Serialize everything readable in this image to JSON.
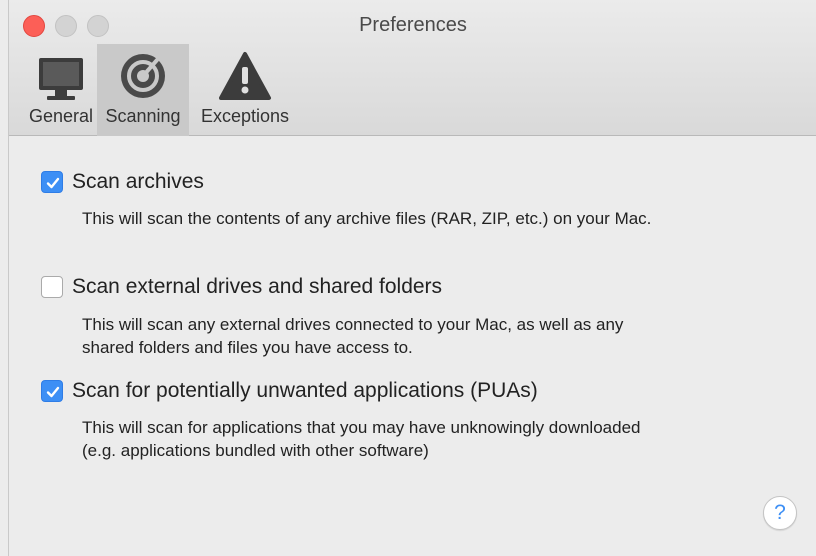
{
  "window": {
    "title": "Preferences"
  },
  "tabs": [
    {
      "label": "General",
      "icon": "monitor-icon",
      "selected": false
    },
    {
      "label": "Scanning",
      "icon": "scan-radar-icon",
      "selected": true
    },
    {
      "label": "Exceptions",
      "icon": "warning-icon",
      "selected": false
    }
  ],
  "options": [
    {
      "label": "Scan archives",
      "checked": true,
      "description": [
        "This will scan the contents of any archive files (RAR, ZIP, etc.) on your Mac."
      ]
    },
    {
      "label": "Scan external drives and shared folders",
      "checked": false,
      "description": [
        "This will scan any external drives connected to your Mac, as well as any",
        "shared folders and files you have access to."
      ]
    },
    {
      "label": "Scan for potentially unwanted applications (PUAs)",
      "checked": true,
      "description": [
        "This will scan for applications that you may have unknowingly downloaded",
        "(e.g. applications bundled with other software)"
      ]
    }
  ],
  "help": {
    "label": "?"
  },
  "colors": {
    "accent": "#3d8ff5",
    "close": "#fc5f57"
  }
}
